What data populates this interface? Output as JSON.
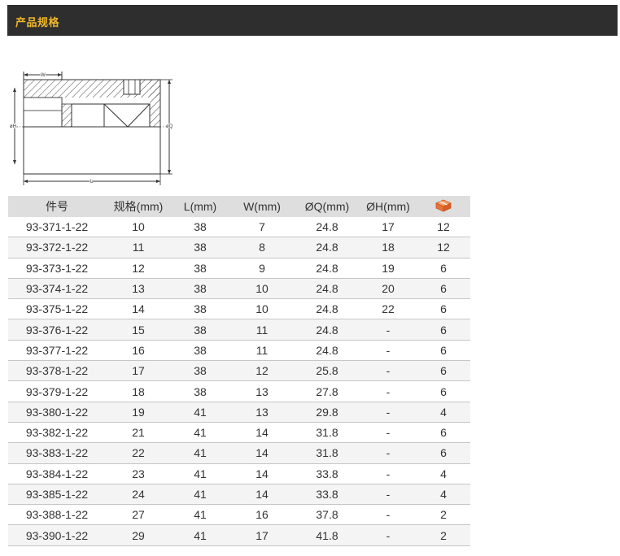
{
  "header": {
    "title": "产品规格"
  },
  "diagram": {
    "label_w": "W",
    "label_h": "øH",
    "label_q": "øQ",
    "label_l": "L"
  },
  "table": {
    "headers": [
      "件号",
      "规格(mm)",
      "L(mm)",
      "W(mm)",
      "ØQ(mm)",
      "ØH(mm)"
    ],
    "package_icon": "package-box-icon",
    "rows": [
      [
        "93-371-1-22",
        "10",
        "38",
        "7",
        "24.8",
        "17",
        "12"
      ],
      [
        "93-372-1-22",
        "11",
        "38",
        "8",
        "24.8",
        "18",
        "12"
      ],
      [
        "93-373-1-22",
        "12",
        "38",
        "9",
        "24.8",
        "19",
        "6"
      ],
      [
        "93-374-1-22",
        "13",
        "38",
        "10",
        "24.8",
        "20",
        "6"
      ],
      [
        "93-375-1-22",
        "14",
        "38",
        "10",
        "24.8",
        "22",
        "6"
      ],
      [
        "93-376-1-22",
        "15",
        "38",
        "11",
        "24.8",
        "-",
        "6"
      ],
      [
        "93-377-1-22",
        "16",
        "38",
        "11",
        "24.8",
        "-",
        "6"
      ],
      [
        "93-378-1-22",
        "17",
        "38",
        "12",
        "25.8",
        "-",
        "6"
      ],
      [
        "93-379-1-22",
        "18",
        "38",
        "13",
        "27.8",
        "-",
        "6"
      ],
      [
        "93-380-1-22",
        "19",
        "41",
        "13",
        "29.8",
        "-",
        "4"
      ],
      [
        "93-382-1-22",
        "21",
        "41",
        "14",
        "31.8",
        "-",
        "6"
      ],
      [
        "93-383-1-22",
        "22",
        "41",
        "14",
        "31.8",
        "-",
        "6"
      ],
      [
        "93-384-1-22",
        "23",
        "41",
        "14",
        "33.8",
        "-",
        "4"
      ],
      [
        "93-385-1-22",
        "24",
        "41",
        "14",
        "33.8",
        "-",
        "4"
      ],
      [
        "93-388-1-22",
        "27",
        "41",
        "16",
        "37.8",
        "-",
        "2"
      ],
      [
        "93-390-1-22",
        "29",
        "41",
        "17",
        "41.8",
        "-",
        "2"
      ]
    ]
  },
  "colors": {
    "header_bg": "#2e2e2e",
    "header_text": "#f0b928",
    "table_header_bg": "#dedede",
    "icon_orange": "#e8733a"
  }
}
